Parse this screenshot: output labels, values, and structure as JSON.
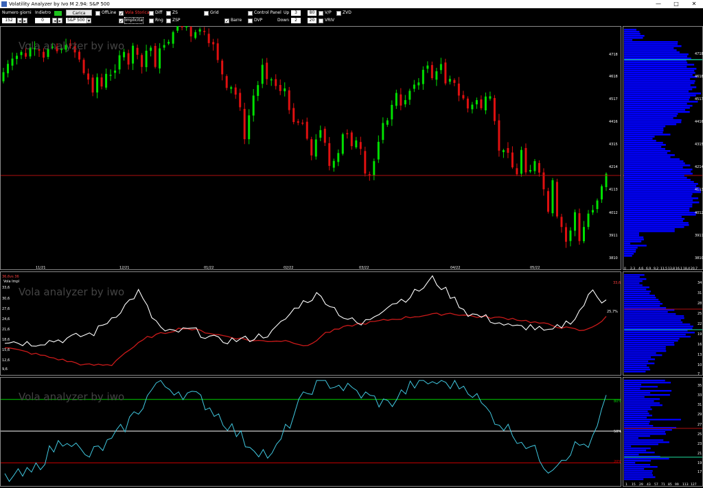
{
  "window": {
    "title": "Volatility Analyzer by Ivo M 2.94: S&P 500",
    "minimize": "—",
    "maximize": "□",
    "close": "✕"
  },
  "toolbar": {
    "numero_giorni_label": "Numero giorni",
    "numero_giorni_value": "152",
    "indietro_label": "Indietro",
    "indietro_value": "0",
    "carica_label": "Carica",
    "symbol_value": "S&P 500",
    "offline_label": "OffLine",
    "vola_storica_label": "Vola Storica",
    "implicita_label": "Implicita",
    "diff_label": "Diff",
    "rng_label": "Rng",
    "zs_label": "ZS",
    "zsp_label": "ZSP",
    "grid_label": "Grid",
    "barre_label": "Barre",
    "control_panel_label": "Control Panel",
    "dvp_label": "DVP",
    "up_label": "Up",
    "up_value": "3",
    "down_label": "Down",
    "down_value": "2",
    "val80": "80",
    "val20": "20",
    "vp_label": "V/P",
    "zvd_label": "ZVD",
    "vrv_label": "VRIV",
    "spin_left": "◄",
    "spin_right": "►",
    "dropdown_arrow": "▼",
    "check_mark": "✓"
  },
  "main_panel": {
    "watermark": "Vola analyzer by iwo",
    "x_labels": [
      "11/21",
      "12/21",
      "01/22",
      "02/22",
      "03/22",
      "04/22",
      "05/22"
    ],
    "y_labels": [
      "4718",
      "4618",
      "4517",
      "4416",
      "4315",
      "4214",
      "4113",
      "4012",
      "3911",
      "3810"
    ],
    "ref_price": 4165,
    "profile_axis_labels": [
      "0",
      "2,3",
      "4,6",
      "6,9",
      "9,2",
      "11,5",
      "13,8",
      "16,1",
      "18,4",
      "20,7"
    ]
  },
  "vol_panel": {
    "watermark": "Vola analyzer by iwo",
    "legend_hist": "36,6vs 36",
    "legend_impl": "Vola Impl",
    "y_labels": [
      "33,6",
      "30,6",
      "27,6",
      "24,6",
      "21,6",
      "18,6",
      "15,6",
      "12,6",
      "9,6"
    ],
    "current_value_label": "25,7%",
    "right_value_label": "33,6",
    "profile_y_labels": [
      "34",
      "31",
      "28",
      "25",
      "22",
      "19",
      "16",
      "13",
      "10",
      "7"
    ]
  },
  "osc_panel": {
    "watermark": "Vola analyzer by iwo",
    "upper_label": "80%",
    "mid_label": "50%",
    "lower_label": "20%",
    "profile_y_labels": [
      "35",
      "33",
      "31",
      "29",
      "27",
      "25",
      "23",
      "21",
      "19",
      "17"
    ],
    "profile_x_labels": [
      "1",
      "15",
      "29",
      "43",
      "57",
      "71",
      "85",
      "99",
      "113",
      "127"
    ]
  },
  "colors": {
    "bull": "#00e000",
    "bear": "#e01010",
    "implied": "#ffffff",
    "historical": "#cc1a1a",
    "oscillator": "#40c8e0",
    "profile": "#0000ff",
    "upper_line": "#00d000",
    "lower_line": "#d00000"
  },
  "chart_data": {
    "type": "candlestick",
    "closes": [
      4598,
      4633,
      4655,
      4667,
      4683,
      4663,
      4702,
      4701,
      4689,
      4659,
      4696,
      4705,
      4686,
      4700,
      4712,
      4708,
      4681,
      4651,
      4594,
      4567,
      4513,
      4577,
      4538,
      4591,
      4587,
      4605,
      4669,
      4683,
      4630,
      4709,
      4671,
      4620,
      4688,
      4701,
      4620,
      4698,
      4712,
      4725,
      4766,
      4791,
      4786,
      4793,
      4748,
      4766,
      4778,
      4768,
      4720,
      4715,
      4649,
      4589,
      4532,
      4535,
      4504,
      4451,
      4317,
      4417,
      4500,
      4544,
      4629,
      4569,
      4568,
      4540,
      4519,
      4530,
      4439,
      4389,
      4386,
      4382,
      4319,
      4249,
      4316,
      4355,
      4302,
      4205,
      4226,
      4259,
      4338,
      4338,
      4288,
      4312,
      4276,
      4173,
      4165,
      4225,
      4306,
      4385,
      4396,
      4461,
      4511,
      4458,
      4481,
      4520,
      4546,
      4555,
      4608,
      4626,
      4573,
      4602,
      4632,
      4551,
      4570,
      4553,
      4500,
      4488,
      4446,
      4462,
      4481,
      4447,
      4496,
      4497,
      4393,
      4269,
      4271,
      4260,
      4199,
      4170,
      4272,
      4178,
      4188,
      4225,
      4177,
      4107,
      4013,
      4145,
      3993,
      3949,
      3887,
      3934,
      4011,
      3890,
      3949,
      4005,
      4020,
      4060,
      4120,
      4172
    ],
    "volatility": {
      "implied_start": 17.6,
      "implied_peak_jan": 33,
      "implied_peak_mar": 36.6,
      "implied_last": 25.7,
      "historical_last": 33.6
    },
    "oscillator_levels": {
      "upper": 80,
      "mid": 50,
      "lower": 20
    }
  }
}
